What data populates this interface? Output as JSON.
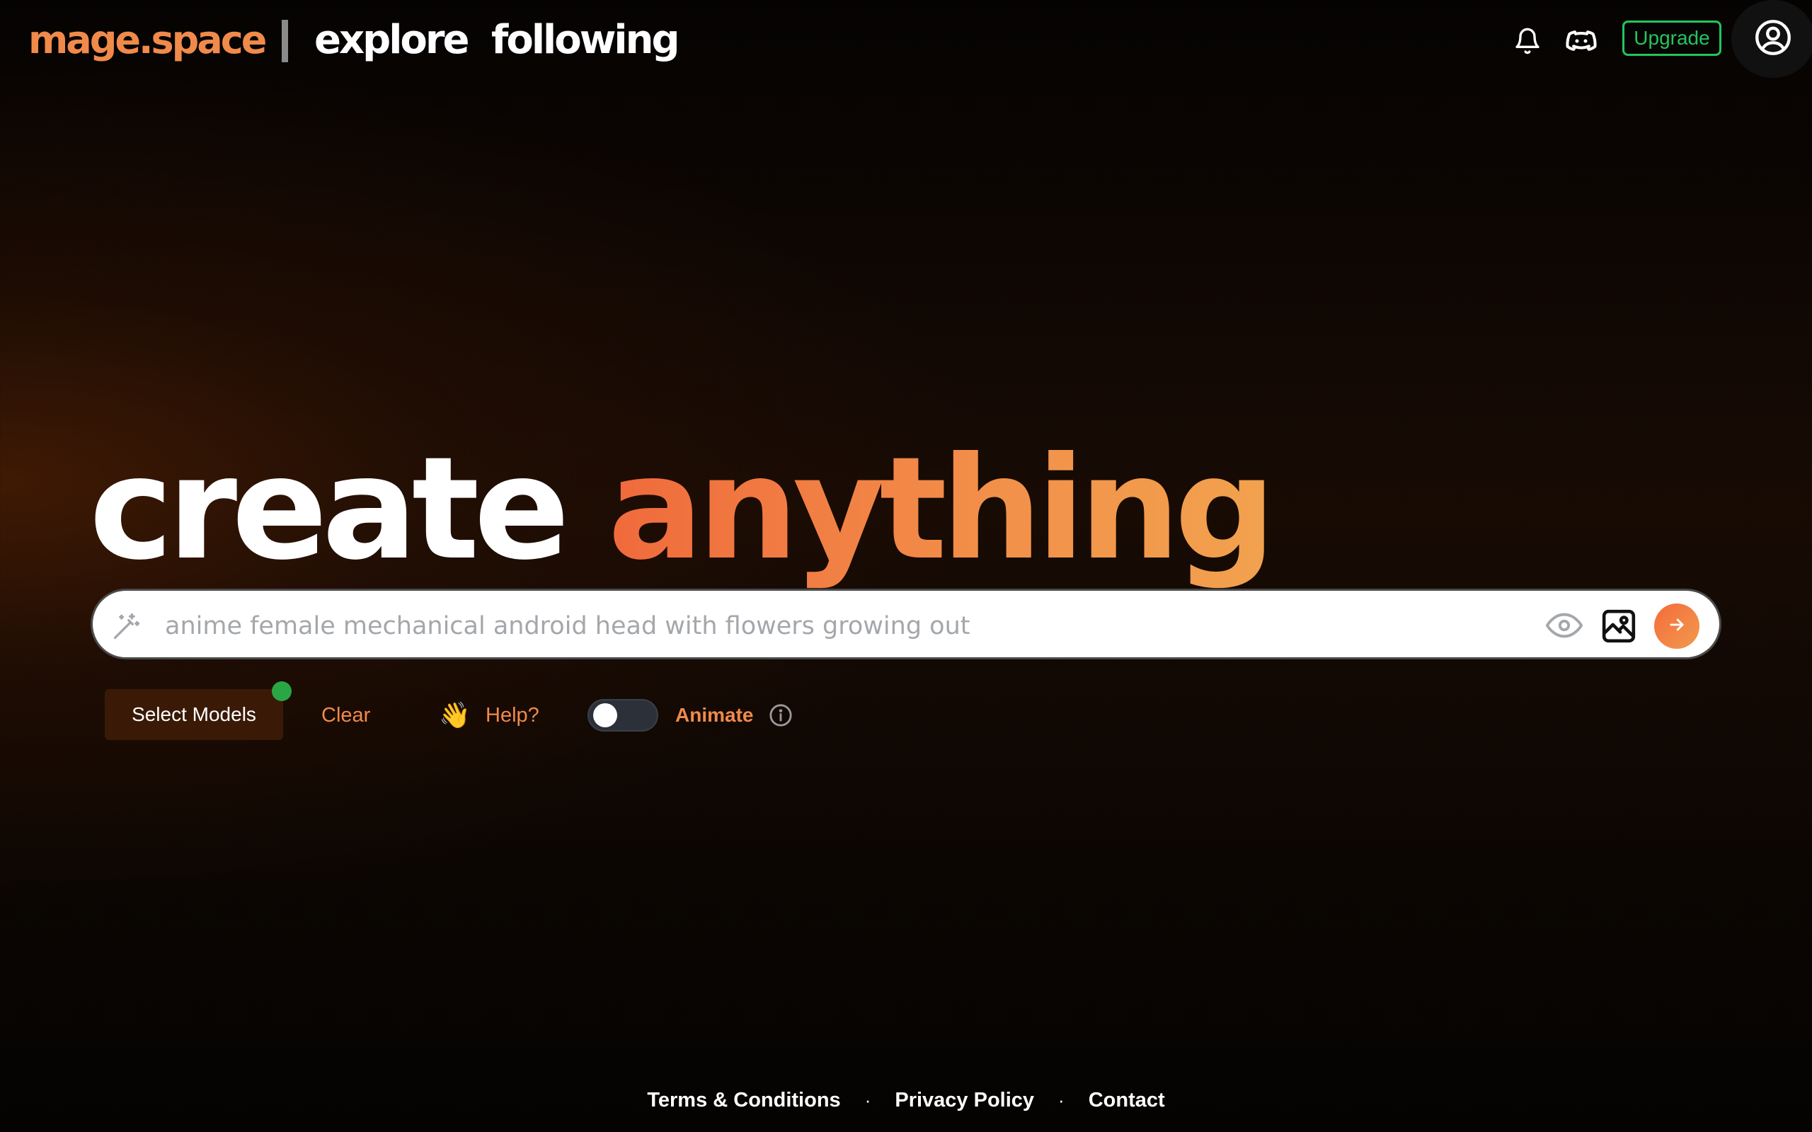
{
  "header": {
    "logo": "mage.space",
    "nav": {
      "explore": "explore",
      "following": "following"
    },
    "icons": {
      "notifications": "bell-icon",
      "discord": "discord-icon",
      "profile": "user-circle-icon"
    },
    "upgrade_label": "Upgrade"
  },
  "hero": {
    "title_part1": "create",
    "title_part2": "anything"
  },
  "search": {
    "value": "",
    "placeholder": "anime female mechanical android head with flowers growing out",
    "icons": {
      "left": "magic-wand-icon",
      "visibility": "eye-icon",
      "image": "image-icon",
      "submit": "arrow-right-icon"
    }
  },
  "controls": {
    "select_models_label": "Select Models",
    "clear_label": "Clear",
    "help_emoji": "👋",
    "help_label": "Help?",
    "animate_label": "Animate",
    "animate_enabled": false
  },
  "footer": {
    "links": [
      "Terms & Conditions",
      "Privacy Policy",
      "Contact"
    ],
    "separator": "·"
  },
  "colors": {
    "accent": "#f08a4b",
    "upgrade": "#22c55e",
    "status_dot": "#2aa744",
    "select_models_bg": "#3a1a06"
  }
}
